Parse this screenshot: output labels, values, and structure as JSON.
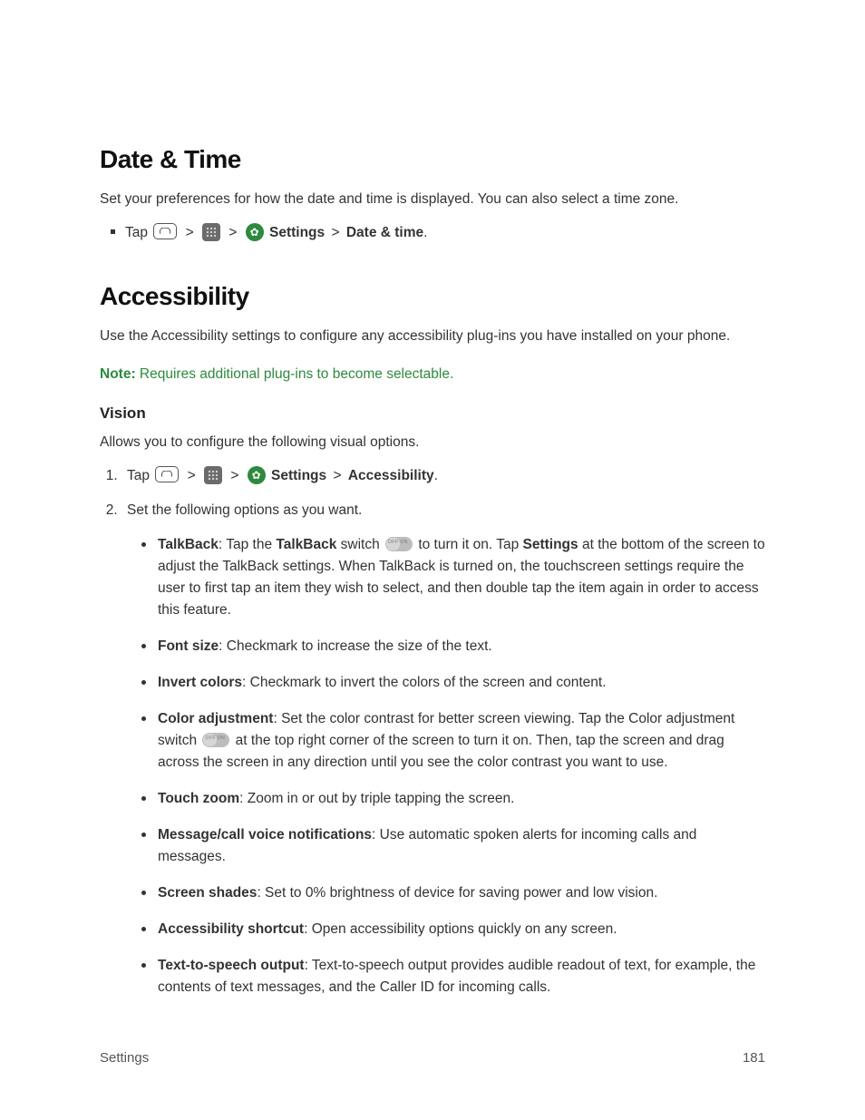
{
  "section1": {
    "heading": "Date & Time",
    "intro": "Set your preferences for how the date and time is displayed. You can also select a time zone.",
    "nav": {
      "prefix": "Tap",
      "settings": "Settings",
      "target": "Date & time"
    }
  },
  "section2": {
    "heading": "Accessibility",
    "intro": "Use the Accessibility settings to configure any accessibility plug-ins you have installed on your phone.",
    "note_label": "Note:",
    "note_text": " Requires additional plug-ins to become selectable.",
    "vision_heading": "Vision",
    "vision_intro": "Allows you to configure the following visual options.",
    "nav": {
      "prefix": "Tap",
      "settings": "Settings",
      "target": "Accessibility"
    },
    "step2_intro": "Set the following options as you want.",
    "options": {
      "talkback": {
        "label": "TalkBack",
        "text1": ": Tap the ",
        "bold2": "TalkBack",
        "text2": " switch ",
        "text3": " to turn it on. Tap ",
        "bold3": "Settings",
        "text4": " at the bottom of the screen to adjust the TalkBack settings. When TalkBack is turned on, the touchscreen settings require the user to first tap an item they wish to select, and then double tap the item again in order to access this feature."
      },
      "fontsize": {
        "label": "Font size",
        "text": ": Checkmark to increase the size of the text."
      },
      "invert": {
        "label": "Invert colors",
        "text": ": Checkmark to invert the colors of the screen and content."
      },
      "coloradj": {
        "label": "Color adjustment",
        "text1": ": Set the color contrast for better screen viewing. Tap the Color adjustment switch ",
        "text2": " at the top right corner of the screen to turn it on. Then, tap the screen and drag across the screen in any direction until you see the color contrast you want to use."
      },
      "touchzoom": {
        "label": "Touch zoom",
        "text": ": Zoom in or out by triple tapping the screen."
      },
      "msgcall": {
        "label": "Message/call voice notifications",
        "text": ": Use automatic spoken alerts for incoming calls and messages."
      },
      "shades": {
        "label": "Screen shades",
        "text": ": Set to 0% brightness of device for saving power and low vision."
      },
      "shortcut": {
        "label": "Accessibility shortcut",
        "text": ": Open accessibility options quickly on any screen."
      },
      "tts": {
        "label": "Text-to-speech output",
        "text": ": Text-to-speech output provides audible readout of text, for example, the contents of text messages, and the Caller ID for incoming calls."
      }
    }
  },
  "footer": {
    "left": "Settings",
    "right": "181"
  },
  "sep": ">"
}
